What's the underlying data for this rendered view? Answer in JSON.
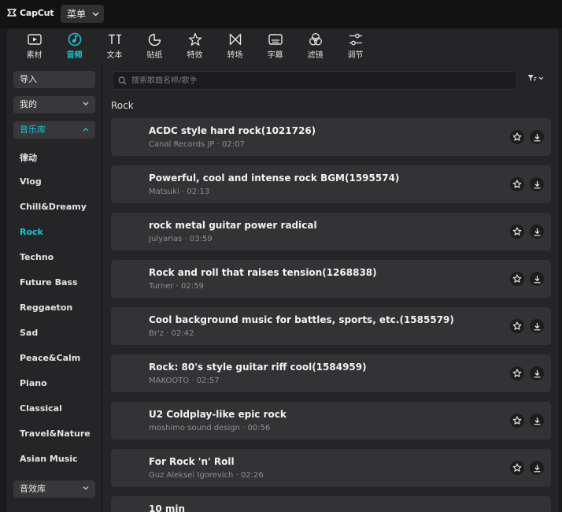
{
  "app": {
    "name": "CapCut",
    "menu_label": "菜单"
  },
  "tabs": [
    {
      "label": "素材",
      "icon": "media-icon",
      "active": false
    },
    {
      "label": "音频",
      "icon": "audio-icon",
      "active": true
    },
    {
      "label": "文本",
      "icon": "text-icon",
      "active": false
    },
    {
      "label": "贴纸",
      "icon": "sticker-icon",
      "active": false
    },
    {
      "label": "特效",
      "icon": "effects-icon",
      "active": false
    },
    {
      "label": "转场",
      "icon": "transition-icon",
      "active": false
    },
    {
      "label": "字幕",
      "icon": "caption-icon",
      "active": false
    },
    {
      "label": "滤镜",
      "icon": "filter-icon",
      "active": false
    },
    {
      "label": "调节",
      "icon": "adjust-icon",
      "active": false
    }
  ],
  "sidebar": {
    "import_label": "导入",
    "mine_label": "我的",
    "library_label": "音乐库",
    "categories": [
      "律动",
      "Vlog",
      "Chill&Dreamy",
      "Rock",
      "Techno",
      "Future Bass",
      "Reggaeton",
      "Sad",
      "Peace&Calm",
      "Piano",
      "Classical",
      "Travel&Nature",
      "Asian Music"
    ],
    "active_category": "Rock",
    "sfx_label": "音效库"
  },
  "search": {
    "placeholder": "搜索歌曲名称/歌手"
  },
  "section_title": "Rock",
  "tracks": [
    {
      "title": "ACDC style hard rock(1021726)",
      "artist": "Canal Records JP",
      "duration": "02:07"
    },
    {
      "title": "Powerful, cool and intense rock BGM(1595574)",
      "artist": "Matsuki",
      "duration": "02:13"
    },
    {
      "title": "rock metal guitar power radical",
      "artist": "Julyarias",
      "duration": "03:59"
    },
    {
      "title": "Rock and roll that raises tension(1268838)",
      "artist": "Turner",
      "duration": "02:59"
    },
    {
      "title": "Cool background music for battles, sports, etc.(1585579)",
      "artist": "Br'z",
      "duration": "02:42"
    },
    {
      "title": "Rock: 80's style guitar riff cool(1584959)",
      "artist": "MAKOOTO",
      "duration": "02:57"
    },
    {
      "title": "U2 Coldplay-like epic rock",
      "artist": "moshimo sound design",
      "duration": "00:56"
    },
    {
      "title": "For Rock 'n' Roll",
      "artist": "Guz Aleksei Igorevich",
      "duration": "02:26"
    },
    {
      "title": "10 min",
      "artist": "",
      "duration": ""
    }
  ],
  "colors": {
    "accent": "#1fc2cf",
    "background": "#1b1b1d",
    "panel": "#252528",
    "row": "#333336"
  }
}
